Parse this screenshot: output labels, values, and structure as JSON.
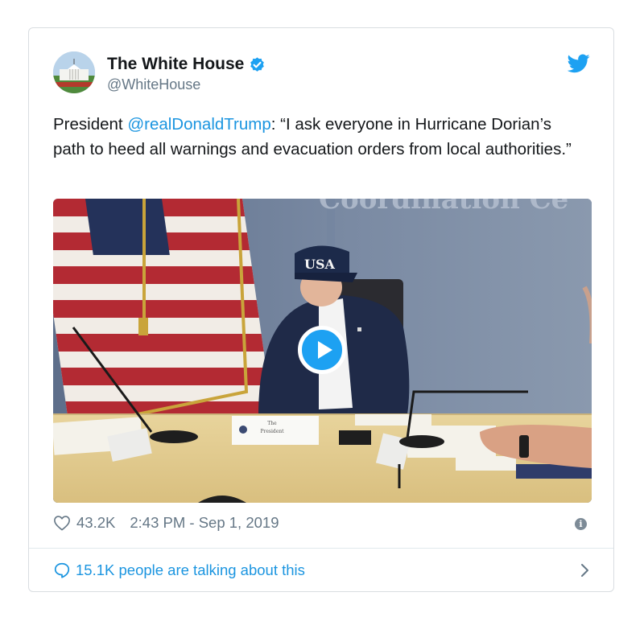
{
  "tweet": {
    "display_name": "The White House",
    "handle": "@WhiteHouse",
    "text_prefix": "President ",
    "mention": "@realDonaldTrump",
    "text_suffix": ": “I ask everyone in Hurricane Dorian’s path to heed all warnings and evacuation orders from local authorities.”",
    "likes": "43.2K",
    "timestamp": "2:43 PM - Sep 1, 2019",
    "talking": "15.1K people are talking about this"
  },
  "media": {
    "cap_text": "USA",
    "placard_line1": "The",
    "placard_line2": "President"
  },
  "colors": {
    "accent": "#1da1f2",
    "link": "#1b95e0",
    "muted": "#657786",
    "verified": "#1da1f2"
  },
  "icons": {
    "avatar": "white-house-avatar",
    "verified": "verified-badge-icon",
    "brand": "twitter-bird-icon",
    "play": "play-icon",
    "like": "heart-icon",
    "info": "info-icon",
    "conversation": "speech-bubble-icon",
    "chevron": "chevron-right-icon"
  }
}
